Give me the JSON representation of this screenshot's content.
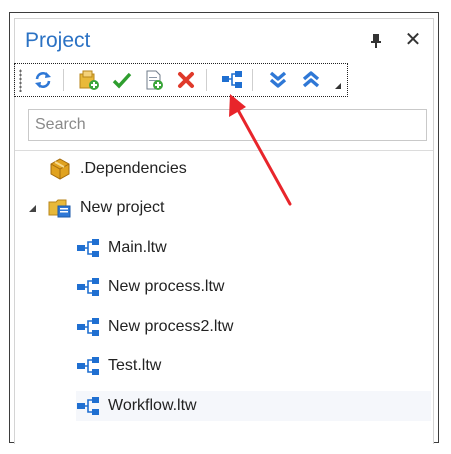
{
  "panel": {
    "title": "Project",
    "close_glyph": "✕"
  },
  "toolbar": {
    "buttons": [
      {
        "name": "refresh-icon"
      },
      {
        "name": "add-folder-icon"
      },
      {
        "name": "check-icon"
      },
      {
        "name": "add-file-icon"
      },
      {
        "name": "delete-icon"
      },
      {
        "name": "workflow-icon"
      },
      {
        "name": "expand-all-icon"
      },
      {
        "name": "collapse-all-icon"
      }
    ]
  },
  "search": {
    "placeholder": "Search"
  },
  "tree": {
    "dependencies_label": ".Dependencies",
    "project_label": "New project",
    "files": [
      {
        "label": "Main.ltw"
      },
      {
        "label": "New process.ltw"
      },
      {
        "label": "New process2.ltw"
      },
      {
        "label": "Test.ltw"
      },
      {
        "label": "Workflow.ltw"
      }
    ]
  },
  "colors": {
    "title": "#2b72c4",
    "annotation_arrow": "#e8252b",
    "workflow_icon": "#1f6fd1"
  }
}
